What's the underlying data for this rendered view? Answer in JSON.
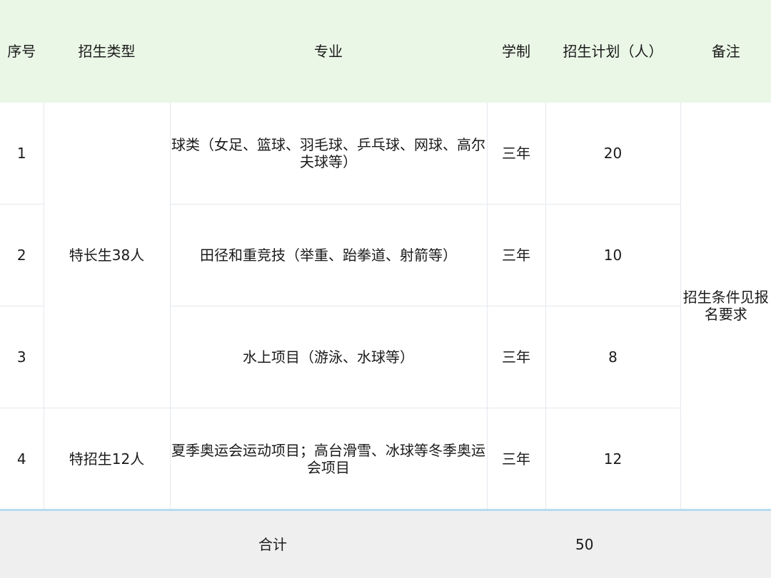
{
  "headers": [
    "序号",
    "招生类型",
    "专业",
    "学制",
    "招生计划（人）",
    "备注"
  ],
  "rows": [
    {
      "no": "1",
      "major": "球类（女足、篮球、羽毛球、乒乓球、网球、高尔夫球等）",
      "duration": "三年",
      "plan": "20"
    },
    {
      "no": "2",
      "major": "田径和重竞技（举重、跆拳道、射箭等）",
      "duration": "三年",
      "plan": "10"
    },
    {
      "no": "3",
      "major": "水上项目（游泳、水球等）",
      "duration": "三年",
      "plan": "8"
    },
    {
      "no": "4",
      "major": "夏季奥运会运动项目；高台滑雪、冰球等冬季奥运会项目",
      "duration": "三年",
      "plan": "12"
    }
  ],
  "types": [
    "特长生38人",
    "特招生12人"
  ],
  "note": "招生条件见报名要求",
  "footer": {
    "label": "合计",
    "total": "50"
  },
  "colors": {
    "header_bg": "#eaf6e6",
    "footer_bg": "#efefef",
    "footer_border": "#b8dbef",
    "grid": "#e4e8ee"
  }
}
